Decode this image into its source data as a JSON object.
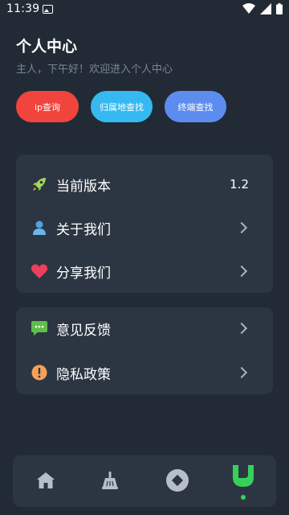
{
  "status_bar": {
    "time": "11:39"
  },
  "header": {
    "title": "个人中心",
    "subtitle": "主人，下午好！欢迎进入个人中心"
  },
  "quick_actions": [
    {
      "label": "ip查询",
      "color": "#f0443c"
    },
    {
      "label": "归属地查找",
      "color": "#36b9f1"
    },
    {
      "label": "终端查找",
      "color": "#5d8cf1"
    }
  ],
  "menu_group1": [
    {
      "label": "当前版本",
      "value": "1.2",
      "icon": "rocket-icon"
    },
    {
      "label": "关于我们",
      "icon": "user-icon"
    },
    {
      "label": "分享我们",
      "icon": "heart-icon"
    }
  ],
  "menu_group2": [
    {
      "label": "意见反馈",
      "icon": "chat-icon"
    },
    {
      "label": "隐私政策",
      "icon": "exclamation-icon"
    }
  ],
  "bottom_nav": [
    {
      "icon": "home-icon",
      "active": false
    },
    {
      "icon": "broom-icon",
      "active": false
    },
    {
      "icon": "diamond-icon",
      "active": false
    },
    {
      "icon": "profile-icon",
      "active": true
    }
  ],
  "colors": {
    "background": "#222b35",
    "card": "#2c3642",
    "accent": "#37d15a"
  }
}
